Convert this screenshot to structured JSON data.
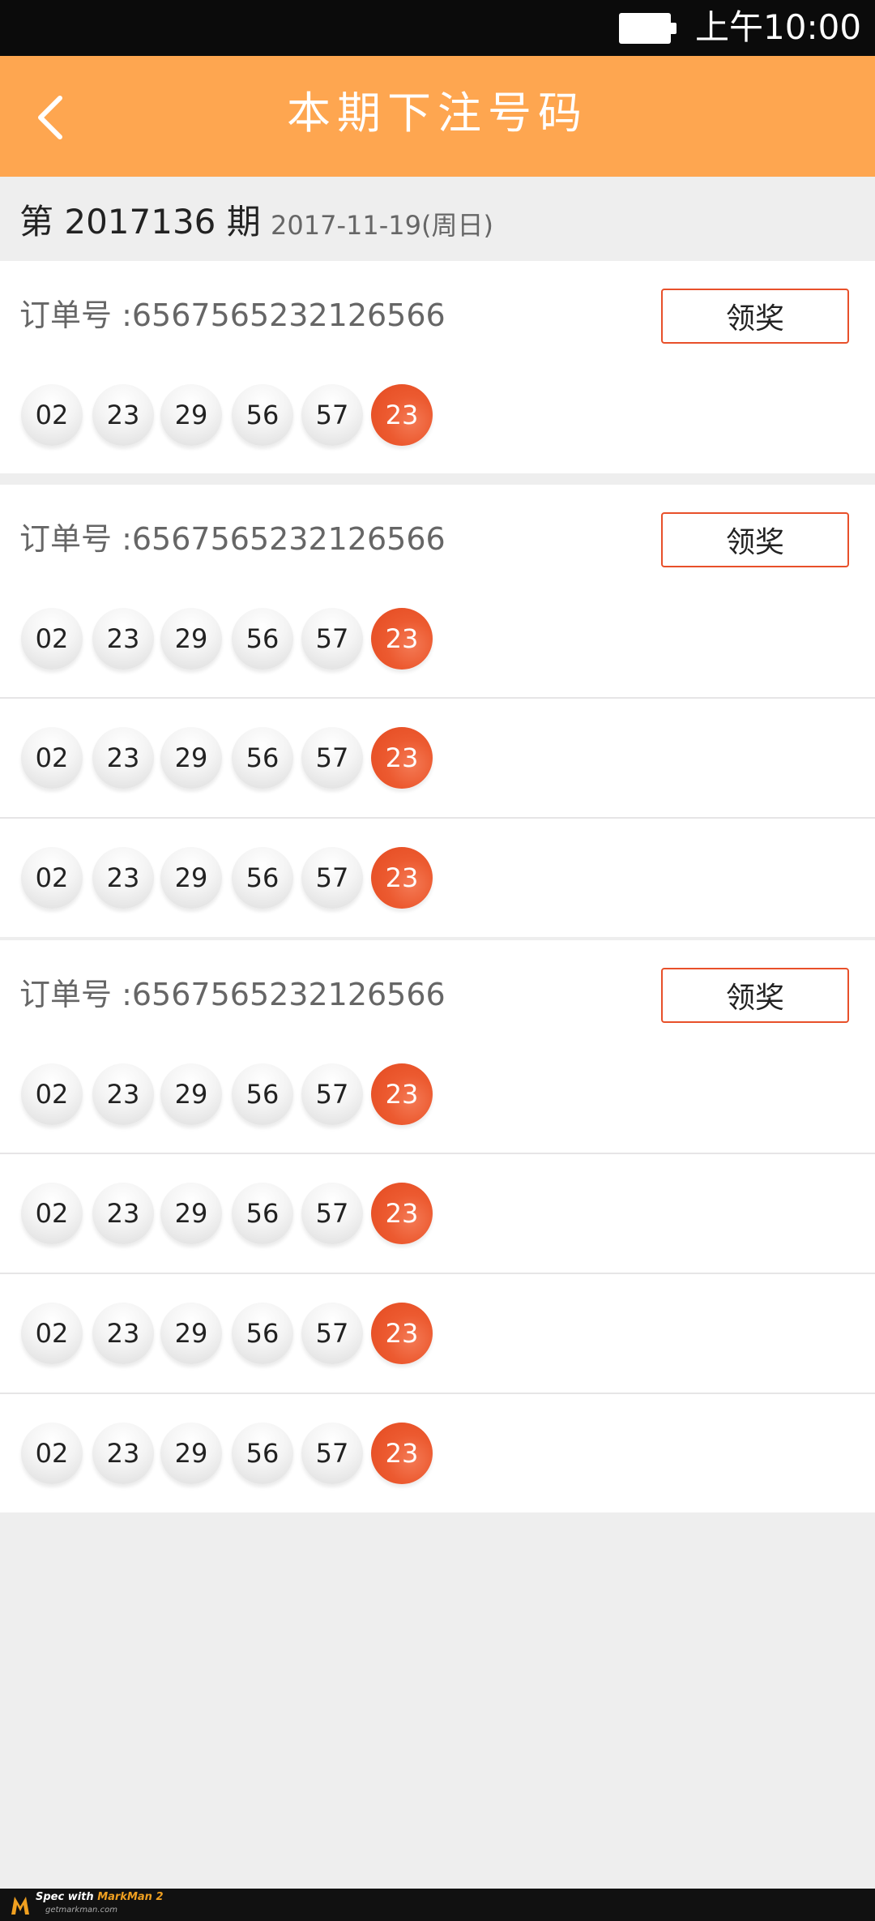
{
  "status_bar": {
    "time": "上午10:00",
    "battery_icon": "battery-full-icon"
  },
  "nav": {
    "title": "本期下注号码",
    "back_icon": "chevron-left-icon"
  },
  "period": {
    "label": "第 2017136 期",
    "date": "2017-11-19(周日)"
  },
  "orders": [
    {
      "order_label": "订单号 :6567565232126566",
      "claim_label": "领奖",
      "rows": [
        [
          "02",
          "23",
          "29",
          "56",
          "57",
          "23"
        ]
      ]
    },
    {
      "order_label": "订单号 :6567565232126566",
      "claim_label": "领奖",
      "rows": [
        [
          "02",
          "23",
          "29",
          "56",
          "57",
          "23"
        ],
        [
          "02",
          "23",
          "29",
          "56",
          "57",
          "23"
        ],
        [
          "02",
          "23",
          "29",
          "56",
          "57",
          "23"
        ]
      ]
    },
    {
      "order_label": "订单号 :6567565232126566",
      "claim_label": "领奖",
      "rows": [
        [
          "02",
          "23",
          "29",
          "56",
          "57",
          "23"
        ],
        [
          "02",
          "23",
          "29",
          "56",
          "57",
          "23"
        ],
        [
          "02",
          "23",
          "29",
          "56",
          "57",
          "23"
        ],
        [
          "02",
          "23",
          "29",
          "56",
          "57",
          "23"
        ]
      ]
    }
  ],
  "footer": {
    "text": "Spec with",
    "brand": "MarkMan 2",
    "site": "getmarkman.com"
  },
  "colors": {
    "nav_bg": "#fea650",
    "red_ball": "#ec5a30",
    "label_text": "#666666",
    "background": "#eeeeee",
    "divider": "#e6e5e6"
  }
}
